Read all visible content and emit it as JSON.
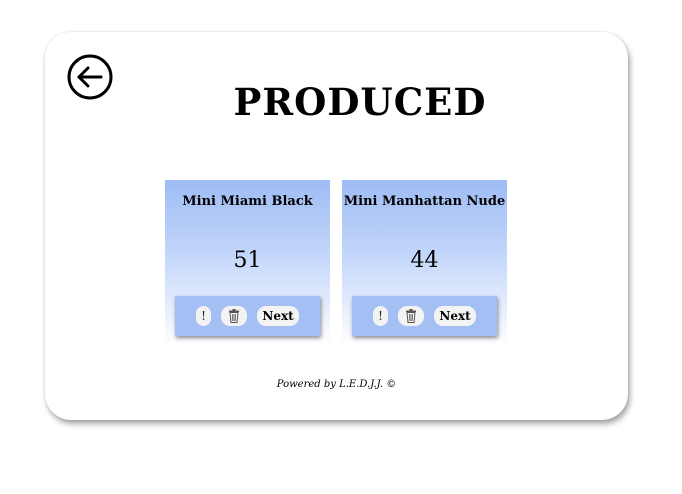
{
  "header": {
    "back_icon": "arrow-left-circle-icon",
    "title": "PRODUCED"
  },
  "cards": [
    {
      "name": "Mini Miami Black",
      "count": "51",
      "alert_label": "!",
      "delete_icon": "trash-icon",
      "next_label": "Next"
    },
    {
      "name": "Mini Manhattan Nude",
      "count": "44",
      "alert_label": "!",
      "delete_icon": "trash-icon",
      "next_label": "Next"
    }
  ],
  "footer": {
    "text": "Powered by L.E.D.J.J. ©"
  },
  "colors": {
    "card_gradient_top": "#9ebcf4",
    "card_actions_bg": "#a3bff3",
    "button_bg": "#f3f3f3"
  }
}
